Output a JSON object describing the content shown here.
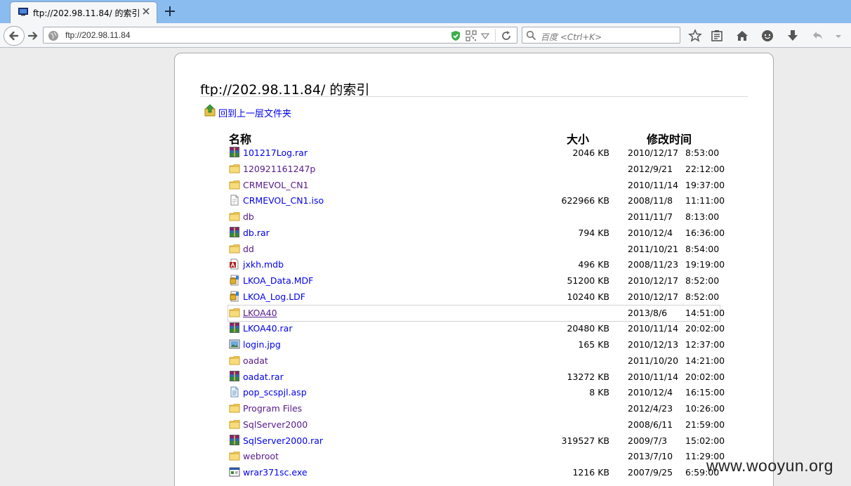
{
  "browser": {
    "tab_title": "ftp://202.98.11.84/ 的索引",
    "url": "ftp://202.98.11.84",
    "search_placeholder": "百度 <Ctrl+K>"
  },
  "page": {
    "title": "ftp://202.98.11.84/ 的索引",
    "up_link": "回到上一层文件夹",
    "columns": {
      "name": "名称",
      "size": "大小",
      "modified": "修改时间"
    }
  },
  "files": [
    {
      "name": "101217Log.rar",
      "icon": "rar-archive-icon",
      "size": "2046 KB",
      "date": "2010/12/17",
      "time": "8:53:00"
    },
    {
      "name": "120921161247p",
      "icon": "folder-icon",
      "size": "",
      "date": "2012/9/21",
      "time": "22:12:00",
      "visited": true
    },
    {
      "name": "CRMEVOL_CN1",
      "icon": "folder-icon",
      "size": "",
      "date": "2010/11/14",
      "time": "19:37:00",
      "visited": true
    },
    {
      "name": "CRMEVOL_CN1.iso",
      "icon": "generic-file-icon",
      "size": "622966 KB",
      "date": "2008/11/8",
      "time": "11:11:00"
    },
    {
      "name": "db",
      "icon": "folder-icon",
      "size": "",
      "date": "2011/11/7",
      "time": "8:13:00",
      "visited": true
    },
    {
      "name": "db.rar",
      "icon": "rar-archive-icon",
      "size": "794 KB",
      "date": "2010/12/4",
      "time": "16:36:00"
    },
    {
      "name": "dd",
      "icon": "folder-icon",
      "size": "",
      "date": "2011/10/21",
      "time": "8:54:00",
      "visited": true
    },
    {
      "name": "jxkh.mdb",
      "icon": "access-db-icon",
      "size": "496 KB",
      "date": "2008/11/23",
      "time": "19:19:00"
    },
    {
      "name": "LKOA_Data.MDF",
      "icon": "database-file-icon",
      "size": "51200 KB",
      "date": "2010/12/17",
      "time": "8:52:00"
    },
    {
      "name": "LKOA_Log.LDF",
      "icon": "database-file-icon",
      "size": "10240 KB",
      "date": "2010/12/17",
      "time": "8:52:00"
    },
    {
      "name": "LKOA40",
      "icon": "folder-icon",
      "size": "",
      "date": "2013/8/6",
      "time": "14:51:00",
      "visited": true,
      "hover": true
    },
    {
      "name": "LKOA40.rar",
      "icon": "rar-archive-icon",
      "size": "20480 KB",
      "date": "2010/11/14",
      "time": "20:02:00"
    },
    {
      "name": "login.jpg",
      "icon": "image-file-icon",
      "size": "165 KB",
      "date": "2010/12/13",
      "time": "12:37:00"
    },
    {
      "name": "oadat",
      "icon": "folder-icon",
      "size": "",
      "date": "2011/10/20",
      "time": "14:21:00",
      "visited": true
    },
    {
      "name": "oadat.rar",
      "icon": "rar-archive-icon",
      "size": "13272 KB",
      "date": "2010/11/14",
      "time": "20:02:00"
    },
    {
      "name": "pop_scspjl.asp",
      "icon": "script-file-icon",
      "size": "8 KB",
      "date": "2010/12/4",
      "time": "16:15:00"
    },
    {
      "name": "Program Files",
      "icon": "folder-icon",
      "size": "",
      "date": "2012/4/23",
      "time": "10:26:00",
      "visited": true
    },
    {
      "name": "SqlServer2000",
      "icon": "folder-icon",
      "size": "",
      "date": "2008/6/11",
      "time": "21:59:00",
      "visited": true
    },
    {
      "name": "SqlServer2000.rar",
      "icon": "rar-archive-icon",
      "size": "319527 KB",
      "date": "2009/7/3",
      "time": "15:02:00"
    },
    {
      "name": "webroot",
      "icon": "folder-icon",
      "size": "",
      "date": "2013/7/10",
      "time": "11:29:00",
      "visited": true
    },
    {
      "name": "wrar371sc.exe",
      "icon": "exe-file-icon",
      "size": "1216 KB",
      "date": "2007/9/25",
      "time": "6:59:00"
    }
  ],
  "watermark": "www.wooyun.org"
}
